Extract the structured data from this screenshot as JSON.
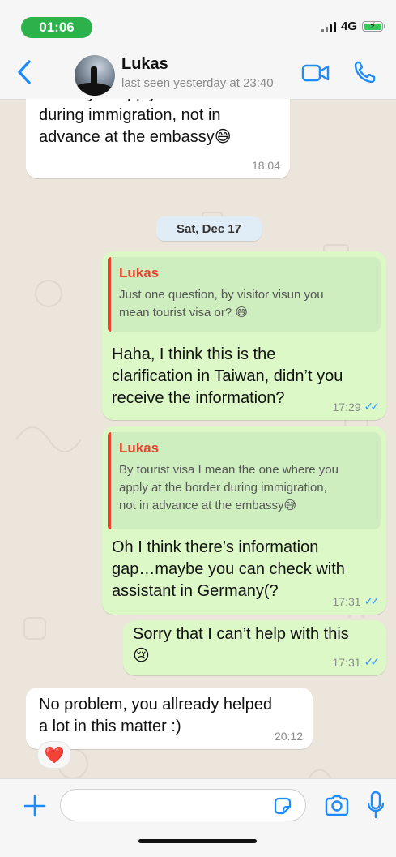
{
  "status_bar": {
    "time": "01:06",
    "network": "4G",
    "battery_icon": "battery-charging-icon",
    "signal_icon": "signal-bars-icon"
  },
  "header": {
    "contact_name": "Lukas",
    "last_seen": "last seen yesterday at 23:40",
    "back_icon": "back-chevron-icon",
    "video_icon": "video-call-icon",
    "phone_icon": "phone-call-icon"
  },
  "chat": {
    "date_chip": "Sat, Dec 17",
    "messages": [
      {
        "direction": "incoming",
        "text": "where you apply at the border\nduring immigration, not in\nadvance at the embassy😅",
        "time": "18:04"
      },
      {
        "direction": "outgoing",
        "quote_author": "Lukas",
        "quote_text": "Just one question, by visitor visun you\nmean tourist visa or? 😅",
        "text": "Haha, I think this is the\nclarification in Taiwan, didn’t you\nreceive the information?",
        "time": "17:29",
        "status": "read"
      },
      {
        "direction": "outgoing",
        "quote_author": "Lukas",
        "quote_text": "By tourist visa I mean the one where you\napply at the border during immigration,\nnot in advance at the embassy😅",
        "text": "Oh I think there’s information\ngap…maybe you can check with\nassistant in Germany(?",
        "time": "17:31",
        "status": "read"
      },
      {
        "direction": "outgoing",
        "text": "Sorry that I can’t help with this\n😢",
        "time": "17:31",
        "status": "read"
      },
      {
        "direction": "incoming",
        "text": "No problem, you allready helped\na lot in this matter :)",
        "time": "20:12",
        "reaction": "❤️"
      }
    ]
  },
  "input_bar": {
    "plus_icon": "plus-icon",
    "sticker_icon": "sticker-icon",
    "camera_icon": "camera-icon",
    "mic_icon": "microphone-icon",
    "text_value": ""
  },
  "colors": {
    "accent": "#1f8bfa",
    "outgoing_bubble": "#dcf8c6",
    "incoming_bubble": "#ffffff",
    "quote_author": "#e8452d",
    "read_ticks": "#3497f9",
    "time_pill": "#2bb24a"
  }
}
